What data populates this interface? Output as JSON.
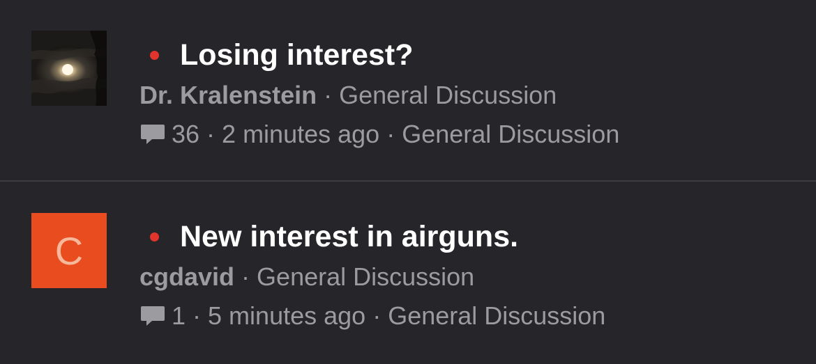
{
  "colors": {
    "background": "#25252a",
    "unread_dot": "#e0342c",
    "letter_avatar_bg": "#e84c1f",
    "divider": "#3b3b40"
  },
  "topics": [
    {
      "title": "Losing interest?",
      "author": "Dr. Kralenstein",
      "category": "General Discussion",
      "reply_count": "36",
      "time_ago": "2 minutes ago",
      "stats_category": "General Discussion",
      "avatar_type": "photo",
      "unread": true
    },
    {
      "title": "New interest in airguns.",
      "author": "cgdavid",
      "category": "General Discussion",
      "reply_count": "1",
      "time_ago": "5 minutes ago",
      "stats_category": "General Discussion",
      "avatar_type": "letter",
      "avatar_letter": "C",
      "unread": true
    }
  ],
  "separator": "·",
  "icons": {
    "comment": "comment-icon",
    "unread": "unread-dot"
  }
}
